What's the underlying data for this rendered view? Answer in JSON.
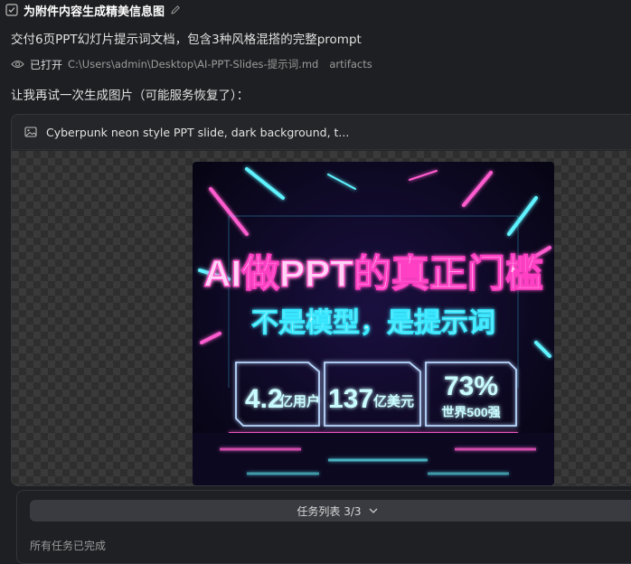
{
  "task": {
    "title": "为附件内容生成精美信息图"
  },
  "messages": {
    "delivery": "交付6页PPT幻灯片提示词文档，包含3种风格混搭的完整prompt",
    "opened_label": "已打开",
    "opened_path": "C:\\Users\\admin\\Desktop\\AI-PPT-Slides-提示词.md",
    "opened_tag": "artifacts",
    "retry": "让我再试一次生成图片（可能服务恢复了）："
  },
  "image_card": {
    "prompt": "Cyberpunk neon style PPT slide, dark background, t..."
  },
  "poster": {
    "headline": "AI做PPT的真正门槛",
    "subheadline": "不是模型，是提示词",
    "stats": [
      {
        "value": "4.2",
        "unit": "亿用户"
      },
      {
        "value": "137",
        "unit": "亿美元"
      },
      {
        "value": "73%",
        "unit": "世界500强"
      }
    ],
    "colors": {
      "pink": "#ff5ccf",
      "cyan": "#5ff3ff",
      "bg": "#0a0818"
    }
  },
  "tasks": {
    "bar_label": "任务列表 3/3",
    "done_text": "所有任务已完成"
  },
  "icons": [
    "task-check-icon",
    "pencil-icon",
    "eye-icon",
    "image-icon",
    "chevron-down-icon"
  ]
}
